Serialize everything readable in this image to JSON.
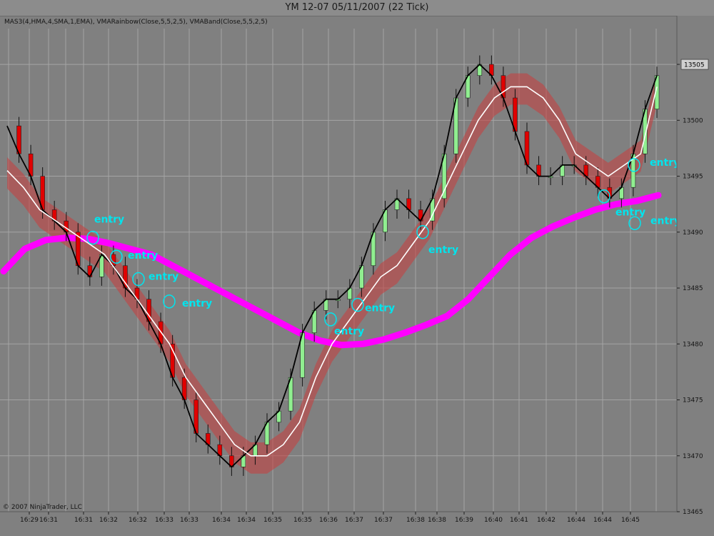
{
  "window": {
    "title": "YM 12-07  05/11/2007  (22 Tick)"
  },
  "indicators_label": "MAS3(4,HMA,4,SMA,1,EMA), VMARainbow(Close,5,5,2,5), VMABand(Close,5,5,2,5)",
  "copyright": "© 2007 NinjaTrader, LLC",
  "colors": {
    "background": "#808080",
    "grid": "#a4a4a4",
    "band_fill": "#c83c3c",
    "rainbow": "#ff00ff",
    "hma": "#ffffff",
    "price_line": "#000000",
    "up_candle": "#90ee90",
    "down_candle": "#e00000",
    "annotation": "#00e5ee",
    "last_price_box": "#d0d0d0"
  },
  "chart_data": {
    "type": "line",
    "title": "",
    "x_ticks": [
      "16:29",
      "16:31",
      "16:31",
      "16:32",
      "16:32",
      "16:33",
      "16:33",
      "16:34",
      "16:34",
      "16:35",
      "16:35",
      "16:36",
      "16:37",
      "16:37",
      "16:38",
      "16:38",
      "16:39",
      "16:40",
      "16:41",
      "16:42",
      "16:44",
      "16:44",
      "16:45"
    ],
    "y_ticks": [
      13465,
      13470,
      13475,
      13480,
      13485,
      13490,
      13495,
      13500,
      13505
    ],
    "ylim": [
      13465,
      13506
    ],
    "last_price_label": "13505",
    "grid": true,
    "series": [
      {
        "values": [
          13499.5,
          13497,
          13495,
          13492,
          13491,
          13490,
          13487,
          13486,
          13488,
          13487,
          13485,
          13484,
          13482,
          13480,
          13477,
          13475,
          13472,
          13471,
          13470,
          13469,
          13470,
          13471,
          13473,
          13474,
          13477,
          13481,
          13483,
          13484,
          13484,
          13485,
          13487,
          13490,
          13492,
          13493,
          13492,
          13491,
          13493,
          13497,
          13502,
          13504,
          13505,
          13504,
          13502,
          13499,
          13496,
          13495,
          13495,
          13496,
          13496,
          13495,
          13494,
          13493,
          13494,
          13497,
          13501,
          13504
        ]
      },
      {
        "values": [
          13495.5,
          13494,
          13492,
          13491,
          13490,
          13489,
          13488,
          13486,
          13484,
          13482,
          13480,
          13477,
          13475,
          13473,
          13471,
          13470,
          13470,
          13471,
          13473,
          13477,
          13480,
          13482,
          13484,
          13486,
          13487,
          13489,
          13491,
          13494,
          13497,
          13500,
          13502,
          13503,
          13503,
          13502,
          13500,
          13497,
          13496,
          13495,
          13496,
          13497,
          13503
        ]
      },
      {
        "values": [
          13486.5,
          13488.5,
          13489.3,
          13489.5,
          13489.4,
          13489,
          13488.5,
          13488,
          13487,
          13486,
          13485,
          13484,
          13483,
          13482,
          13481,
          13480.3,
          13479.9,
          13480,
          13480.4,
          13481,
          13481.7,
          13482.5,
          13484,
          13486,
          13488,
          13489.5,
          13490.5,
          13491.3,
          13492,
          13492.5,
          13492.8,
          13493.3
        ]
      }
    ],
    "annotations": [
      {
        "text": "entry",
        "price": 13489.5
      },
      {
        "text": "entry",
        "price": 13487.8
      },
      {
        "text": "entry",
        "price": 13485.8
      },
      {
        "text": "entry",
        "price": 13483.8
      },
      {
        "text": "entry",
        "price": 13482.2
      },
      {
        "text": "entry",
        "price": 13483.5
      },
      {
        "text": "entry",
        "price": 13490
      },
      {
        "text": "entry",
        "price": 13493.2
      },
      {
        "text": "entry",
        "price": 13490.8
      },
      {
        "text": "entry",
        "price": 13496
      }
    ]
  }
}
